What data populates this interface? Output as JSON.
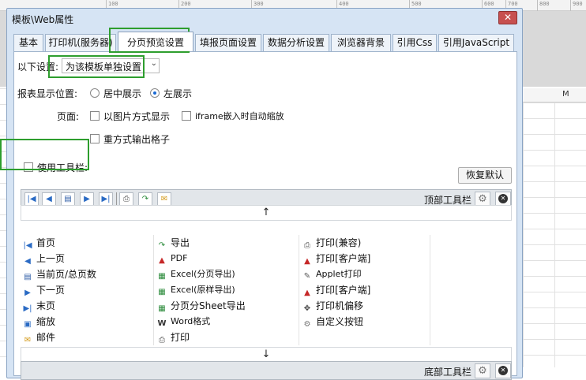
{
  "background": {
    "ruler_ticks": [
      "100",
      "200",
      "300",
      "400",
      "500",
      "600",
      "700",
      "800",
      "900"
    ],
    "column_header": "M"
  },
  "dialog": {
    "title": "模板\\Web属性",
    "close_label": "✕"
  },
  "tabs": [
    {
      "label": "基本"
    },
    {
      "label": "打印机(服务器)"
    },
    {
      "label": "分页预览设置"
    },
    {
      "label": "填报页面设置"
    },
    {
      "label": "数据分析设置"
    },
    {
      "label": "浏览器背景"
    },
    {
      "label": "引用Css"
    },
    {
      "label": "引用JavaScript"
    }
  ],
  "settings": {
    "mode_label": "以下设置:",
    "mode_value": "为该模板单独设置",
    "position_label": "报表显示位置:",
    "position_center": "居中展示",
    "position_left": "左展示",
    "page_label": "页面:",
    "opt_image_mode": "以图片方式显示",
    "opt_iframe_zoom": "iframe嵌入时自动缩放",
    "opt_repeat_grid": "重方式输出格子",
    "use_toolbar": "使用工具栏:",
    "restore_default": "恢复默认"
  },
  "toolbar": {
    "top_label": "顶部工具栏",
    "bottom_label": "底部工具栏",
    "up_arrow": "↑",
    "down_arrow": "↓"
  },
  "buttons_col1": [
    "首页",
    "上一页",
    "当前页/总页数",
    "下一页",
    "末页",
    "缩放",
    "邮件"
  ],
  "buttons_col2": [
    "导出",
    "PDF",
    "Excel(分页导出)",
    "Excel(原样导出)",
    "分页分Sheet导出",
    "Word格式",
    "打印"
  ],
  "buttons_col3": [
    "打印(兼容)",
    "打印[客户端]",
    "Applet打印",
    "打印[客户端]",
    "打印机偏移",
    "自定义按钮"
  ]
}
